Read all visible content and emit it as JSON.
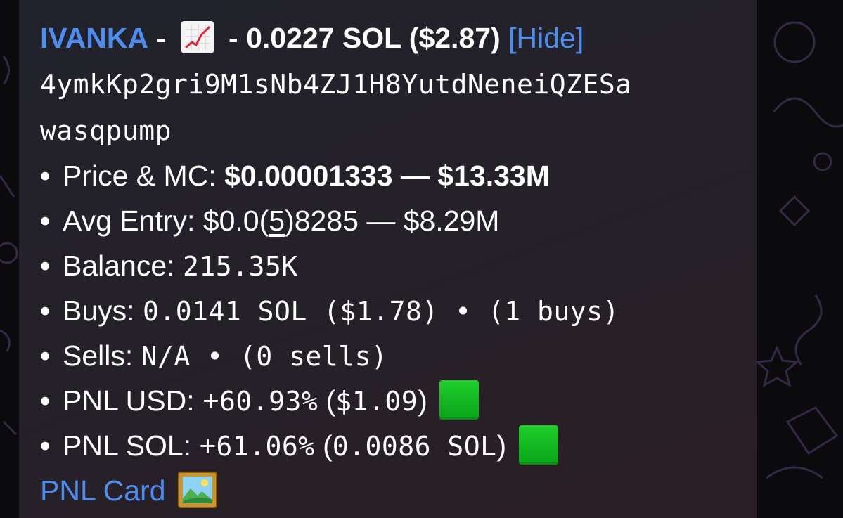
{
  "message": {
    "token_name": "IVANKA",
    "separator": "-",
    "header_amount": "0.0227 SOL ($2.87)",
    "hide_link": "[Hide]",
    "contract_line1": "4ymkKp2gri9M1sNb4ZJ1H8YutdNeneiQZESa",
    "contract_line2": "wasqpump",
    "bullet": "•",
    "price_mc": {
      "label": "Price & MC:",
      "value": "$0.00001333 — $13.33M"
    },
    "avg_entry": {
      "label": "Avg Entry:",
      "prefix": "$0.0(",
      "zeros": "5",
      "suffix": ")8285 — $8.29M"
    },
    "balance": {
      "label": "Balance:",
      "value": "215.35K"
    },
    "buys": {
      "label": "Buys:",
      "value": "0.0141 SOL ($1.78) • (1 buys)"
    },
    "sells": {
      "label": "Sells:",
      "value": "N/A • (0 sells)"
    },
    "pnl_usd": {
      "label": "PNL USD:",
      "pct_sign": "+",
      "pct": "60.93%",
      "paren_open": "(",
      "amount": "$1.09",
      "paren_close": ")",
      "status_icon": "green-square-icon"
    },
    "pnl_sol": {
      "label": "PNL SOL:",
      "pct_sign": "+",
      "pct": "61.06%",
      "paren_open": "(",
      "amount": "0.0086 SOL",
      "paren_close": ")",
      "status_icon": "green-square-icon"
    },
    "pnl_card_link": "PNL Card",
    "pnl_card_icon": "framed-picture-icon",
    "chart_icon": "chart-increasing-icon"
  },
  "colors": {
    "link": "#4e8df0",
    "text": "#ffffff",
    "bubble": "#24222a",
    "status_green": "#14b825"
  }
}
